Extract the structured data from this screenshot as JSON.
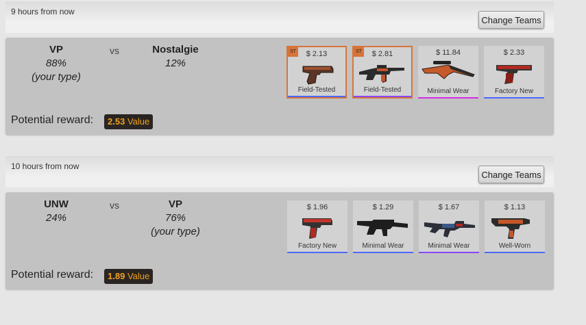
{
  "colors": {
    "stattrak": "#d8743a",
    "rarity_blue": "#4b69ff",
    "rarity_purple": "#8847ff",
    "rarity_pink": "#d32ee6",
    "reward_text": "#f0a020"
  },
  "matches": [
    {
      "time": "9 hours from now",
      "change_label": "Change Teams",
      "team_a": {
        "name": "VP",
        "pct": "88%",
        "note": "(your type)"
      },
      "vs": "vs",
      "team_b": {
        "name": "Nostalgie",
        "pct": "12%",
        "note": ""
      },
      "reward_label": "Potential reward:",
      "reward_value": "2.53",
      "reward_unit": "Value",
      "items": [
        {
          "price": "$ 2.13",
          "wear": "Field-Tested",
          "st": "ST",
          "icon": "pistol-icon",
          "rarity": "#4b69ff"
        },
        {
          "price": "$ 2.81",
          "wear": "Field-Tested",
          "st": "ST",
          "icon": "rifle-icon",
          "rarity": "#8847ff"
        },
        {
          "price": "$ 11.84",
          "wear": "Minimal Wear",
          "st": "",
          "icon": "sniper-rifle-icon",
          "rarity": "#d32ee6"
        },
        {
          "price": "$ 2.33",
          "wear": "Factory New",
          "st": "",
          "icon": "pistol-icon",
          "rarity": "#4b69ff"
        }
      ]
    },
    {
      "time": "10 hours from now",
      "change_label": "Change Teams",
      "team_a": {
        "name": "UNW",
        "pct": "24%",
        "note": ""
      },
      "vs": "vs",
      "team_b": {
        "name": "VP",
        "pct": "76%",
        "note": "(your type)"
      },
      "reward_label": "Potential reward:",
      "reward_value": "1.89",
      "reward_unit": "Value",
      "items": [
        {
          "price": "$ 1.96",
          "wear": "Factory New",
          "st": "",
          "icon": "pistol-icon",
          "rarity": "#4b69ff"
        },
        {
          "price": "$ 1.29",
          "wear": "Minimal Wear",
          "st": "",
          "icon": "rifle-icon",
          "rarity": "#4b69ff"
        },
        {
          "price": "$ 1.67",
          "wear": "Minimal Wear",
          "st": "",
          "icon": "rifle-icon",
          "rarity": "#8847ff"
        },
        {
          "price": "$ 1.13",
          "wear": "Well-Worn",
          "st": "",
          "icon": "smg-icon",
          "rarity": "#4b69ff"
        }
      ]
    }
  ]
}
